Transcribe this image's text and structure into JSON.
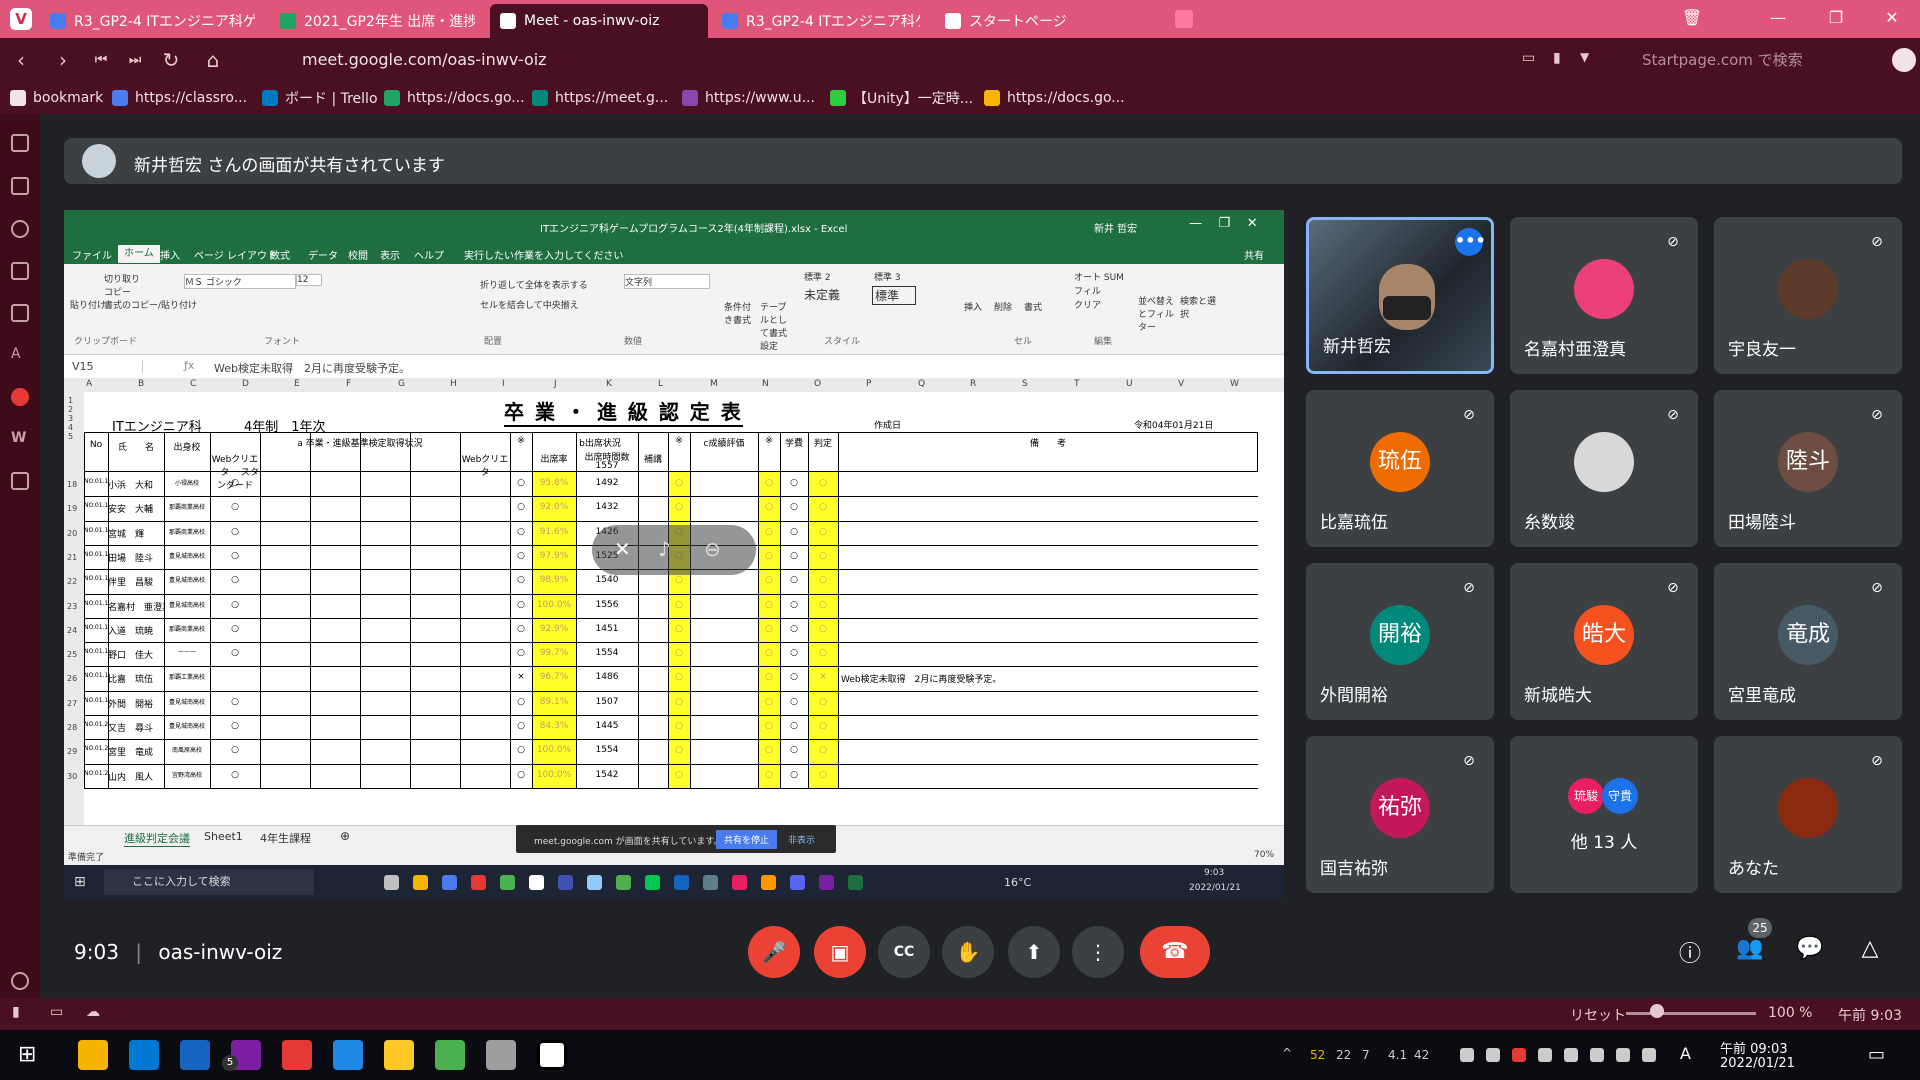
{
  "browser": {
    "tabs": [
      {
        "label": "R3_GP2-4 ITエンジニア科ゲー",
        "color": "#4a7cf0"
      },
      {
        "label": "2021_GP2年生 出席・進捗確",
        "color": "#1fa463"
      },
      {
        "label": "Meet - oas-inwv-oiz",
        "color": "#ffffff"
      },
      {
        "label": "R3_GP2-4 ITエンジニア科ゲー",
        "color": "#4a7cf0"
      },
      {
        "label": "スタートページ",
        "color": "#ffffff"
      }
    ],
    "url": "meet.google.com/oas-inwv-oiz",
    "search_placeholder": "Startpage.com で検索",
    "bookmarks": [
      {
        "label": "bookmark",
        "color": "#f1e3e7"
      },
      {
        "label": "https://classro...",
        "color": "#4a7cf0"
      },
      {
        "label": "ボード | Trello",
        "color": "#0079bf"
      },
      {
        "label": "https://docs.go...",
        "color": "#1fa463"
      },
      {
        "label": "https://meet.g...",
        "color": "#00897b"
      },
      {
        "label": "https://www.u...",
        "color": "#8e44ad"
      },
      {
        "label": "【Unity】一定時...",
        "color": "#2ecc40"
      },
      {
        "label": "https://docs.go...",
        "color": "#f4b400"
      }
    ]
  },
  "meet": {
    "presenter_banner": "新井哲宏 さんの画面が共有されています",
    "time": "9:03",
    "meeting_code": "oas-inwv-oiz",
    "participant_count": "25",
    "tiles": [
      {
        "name": "新井哲宏",
        "initial": "",
        "color": "#2a3a4a"
      },
      {
        "name": "名嘉村亜澄真",
        "initial": "",
        "color": "#ec407a"
      },
      {
        "name": "宇良友一",
        "initial": "",
        "color": "#5d3a2a"
      },
      {
        "name": "比嘉琉伍",
        "initial": "琉伍",
        "color": "#ef6c00"
      },
      {
        "name": "糸数竣",
        "initial": "",
        "color": "#d8d8d8"
      },
      {
        "name": "田場陸斗",
        "initial": "陸斗",
        "color": "#6d4c41"
      },
      {
        "name": "外間開裕",
        "initial": "開裕",
        "color": "#00897b"
      },
      {
        "name": "新城皓大",
        "initial": "皓大",
        "color": "#f4511e"
      },
      {
        "name": "宮里竜成",
        "initial": "竜成",
        "color": "#455a64"
      },
      {
        "name": "国吉祐弥",
        "initial": "祐弥",
        "color": "#c2185b"
      },
      {
        "name": "他 13 人",
        "initial": "",
        "color": "#3c4043"
      },
      {
        "name": "あなた",
        "initial": "",
        "color": "#8a2a10"
      }
    ],
    "others_avatars": [
      "琉駿",
      "守貴"
    ]
  },
  "excel": {
    "title": "ITエンジニア科ゲームプログラムコース2年(4年制課程).xlsx - Excel",
    "user": "新井 哲宏",
    "ribbon_tabs": [
      "ファイル",
      "ホーム",
      "挿入",
      "ページ レイアウト",
      "数式",
      "データ",
      "校閲",
      "表示",
      "ヘルプ",
      "実行したい作業を入力してください",
      "共有"
    ],
    "ribbon_groups": [
      "クリップボード",
      "フォント",
      "配置",
      "数値",
      "スタイル",
      "セル",
      "編集"
    ],
    "clipboard": [
      "貼り付け",
      "切り取り",
      "コピー",
      "書式のコピー/貼り付け"
    ],
    "font_name": "ＭＳ ゴシック",
    "font_size": "12",
    "align": [
      "折り返して全体を表示する",
      "セルを結合して中央揃え"
    ],
    "number_format": "文字列",
    "styles": [
      "標準 2",
      "標準 3",
      "未定義",
      "標準"
    ],
    "style_btns": [
      "条件付き書式",
      "テーブルとして書式設定"
    ],
    "cells_btns": [
      "挿入",
      "削除",
      "書式"
    ],
    "edit_btns": [
      "オート SUM",
      "フィル",
      "クリア",
      "並べ替えとフィルター",
      "検索と選択"
    ],
    "cell_ref": "V15",
    "formula": "Web検定未取得　2月に再度受験予定。",
    "sheet_title": "卒 業 ・ 進 級 認 定 表",
    "dept": "ITエンジニア科",
    "course": "4年制　1年次",
    "created_label": "作成日",
    "created_date": "令和04年01月21日",
    "headers": {
      "no": "No",
      "name": "氏　　名",
      "school": "出身校",
      "criteria": "a 卒業・進級基準検定取得状況",
      "note": "※",
      "attendance": "b出席状況",
      "rate": "出席率",
      "hours": "出席時間数",
      "hours_total": "1557",
      "makeup": "補講",
      "grade": "c成績評価",
      "fee": "学費",
      "judge": "判定",
      "remarks": "備　　考",
      "web_creator_std": "Webクリエーター スタンダード",
      "web_creator": "Webクリエーター"
    },
    "rows": [
      {
        "row": "18",
        "no": "NO.01.10",
        "name": "小浜　大和",
        "school": "小禄高校",
        "c1": "○",
        "n1": "○",
        "rate": "95.8%",
        "hours": "1492",
        "n2": "○",
        "g": "○",
        "fee": "○",
        "judge": "○",
        "remark": ""
      },
      {
        "row": "19",
        "no": "NO.01.11",
        "name": "安安　大輔",
        "school": "那覇商業高校",
        "c1": "○",
        "n1": "○",
        "rate": "92.0%",
        "hours": "1432",
        "n2": "○",
        "g": "○",
        "fee": "○",
        "judge": "○",
        "remark": ""
      },
      {
        "row": "20",
        "no": "NO.01.12",
        "name": "宮城　輝",
        "school": "那覇商業高校",
        "c1": "○",
        "n1": "○",
        "rate": "91.6%",
        "hours": "1426",
        "n2": "○",
        "g": "○",
        "fee": "○",
        "judge": "○",
        "remark": ""
      },
      {
        "row": "21",
        "no": "NO.01.13",
        "name": "田場　陸斗",
        "school": "豊見城南高校",
        "c1": "○",
        "n1": "○",
        "rate": "97.9%",
        "hours": "1525",
        "n2": "○",
        "g": "○",
        "fee": "○",
        "judge": "○",
        "remark": ""
      },
      {
        "row": "22",
        "no": "NO.01.14",
        "name": "伴里　昌駿",
        "school": "豊見城南高校",
        "c1": "○",
        "n1": "○",
        "rate": "98.9%",
        "hours": "1540",
        "n2": "○",
        "g": "○",
        "fee": "○",
        "judge": "○",
        "remark": ""
      },
      {
        "row": "23",
        "no": "NO.01.15",
        "name": "名嘉村　亜澄真",
        "school": "豊見城南高校",
        "c1": "○",
        "n1": "○",
        "rate": "100.0%",
        "hours": "1556",
        "n2": "○",
        "g": "○",
        "fee": "○",
        "judge": "○",
        "remark": ""
      },
      {
        "row": "24",
        "no": "NO.01.16",
        "name": "入道　琉暁",
        "school": "那覇商業高校",
        "c1": "○",
        "n1": "○",
        "rate": "92.9%",
        "hours": "1451",
        "n2": "○",
        "g": "○",
        "fee": "○",
        "judge": "○",
        "remark": ""
      },
      {
        "row": "25",
        "no": "NO.01.17",
        "name": "野口　佳大",
        "school": "———",
        "c1": "○",
        "n1": "○",
        "rate": "99.7%",
        "hours": "1554",
        "n2": "○",
        "g": "○",
        "fee": "○",
        "judge": "○",
        "remark": ""
      },
      {
        "row": "26",
        "no": "NO.01.18",
        "name": "比嘉　琉伍",
        "school": "那覇工業高校",
        "c1": "",
        "n1": "×",
        "rate": "96.7%",
        "hours": "1486",
        "n2": "○",
        "g": "○",
        "fee": "○",
        "judge": "×",
        "remark": "Web検定未取得　2月に再度受験予定。"
      },
      {
        "row": "27",
        "no": "NO.01.19",
        "name": "外間　開裕",
        "school": "豊見城南高校",
        "c1": "○",
        "n1": "○",
        "rate": "89.1%",
        "hours": "1507",
        "n2": "○",
        "g": "○",
        "fee": "○",
        "judge": "○",
        "remark": ""
      },
      {
        "row": "28",
        "no": "NO.01.20",
        "name": "又吉　尋斗",
        "school": "豊見城南高校",
        "c1": "○",
        "n1": "○",
        "rate": "84.3%",
        "hours": "1445",
        "n2": "○",
        "g": "○",
        "fee": "○",
        "judge": "○",
        "remark": ""
      },
      {
        "row": "29",
        "no": "NO.01.21",
        "name": "宮里　竜成",
        "school": "南風原高校",
        "c1": "○",
        "n1": "○",
        "rate": "100.0%",
        "hours": "1554",
        "n2": "○",
        "g": "○",
        "fee": "○",
        "judge": "○",
        "remark": ""
      },
      {
        "row": "30",
        "no": "NO.01.22",
        "name": "山内　風人",
        "school": "宜野湾高校",
        "c1": "○",
        "n1": "○",
        "rate": "100.0%",
        "hours": "1542",
        "n2": "○",
        "g": "○",
        "fee": "○",
        "judge": "○",
        "remark": ""
      }
    ],
    "sheet_tabs": [
      "進級判定会議",
      "Sheet1",
      "4年生課程"
    ],
    "status": "準備完了",
    "zoom": "70%",
    "share_msg": "meet.google.com が画面を共有しています。",
    "share_stop": "共有を停止",
    "share_hide": "非表示",
    "win_search": "ここに入力して検索",
    "win_temp": "16°C",
    "win_time": "9:03",
    "win_date": "2022/01/21"
  },
  "vivaldi_status": {
    "reset": "リセット",
    "zoom": "100 %",
    "time": "午前 9:03"
  },
  "taskbar": {
    "stats": [
      "52",
      "22",
      "7",
      "4.1",
      "42"
    ],
    "ime": "A",
    "time": "午前 09:03",
    "date": "2022/01/21",
    "mail_badge": "5"
  }
}
